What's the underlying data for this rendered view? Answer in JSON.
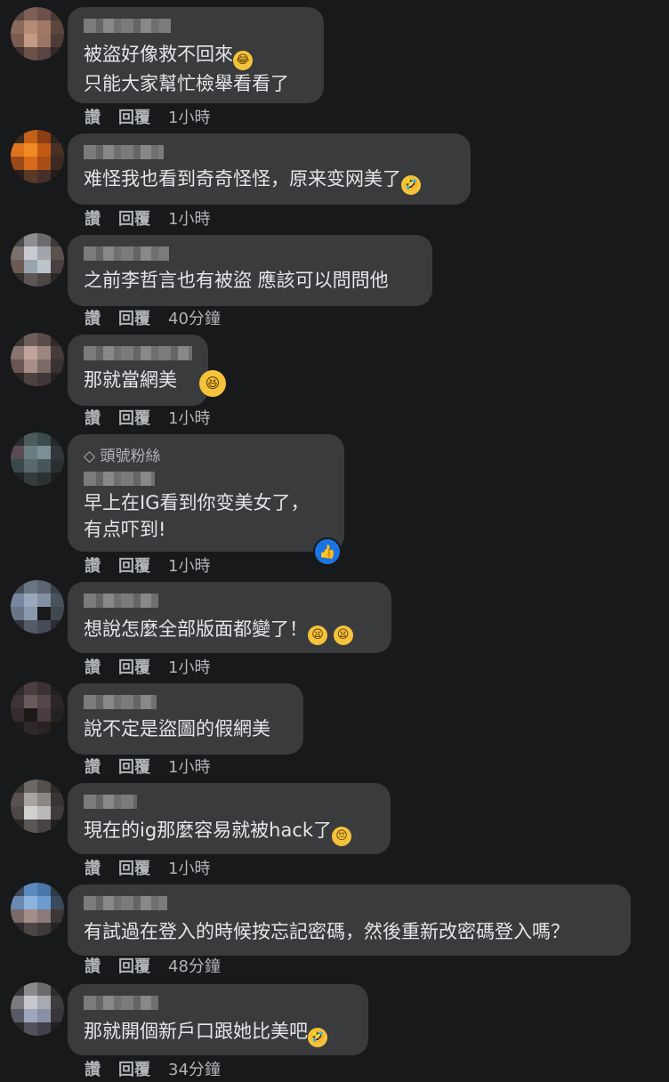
{
  "comments": [
    {
      "lines": [
        "被盜好像救不回來",
        "只能大家幫忙檢舉看看了"
      ],
      "emoji": [
        "crying-laughing-face"
      ],
      "like": "讚",
      "reply": "回覆",
      "time": "1小時"
    },
    {
      "lines": [
        "难怪我也看到奇奇怪怪，原来变网美了"
      ],
      "emoji": [
        "rolling-laughing-face"
      ],
      "like": "讚",
      "reply": "回覆",
      "time": "1小時"
    },
    {
      "lines": [
        "之前李哲言也有被盜 應該可以問問他"
      ],
      "like": "讚",
      "reply": "回覆",
      "time": "40分鐘"
    },
    {
      "lines": [
        "那就當網美"
      ],
      "emoji": [
        "squinting-face"
      ],
      "like": "讚",
      "reply": "回覆",
      "time": "1小時"
    },
    {
      "badge": "頭號粉絲",
      "lines": [
        "早上在IG看到你变美女了，",
        "有点吓到!"
      ],
      "reaction": "like",
      "like": "讚",
      "reply": "回覆",
      "time": "1小時"
    },
    {
      "lines": [
        "想說怎麼全部版面都變了！"
      ],
      "emoji": [
        "frowning-face",
        "frowning-face"
      ],
      "like": "讚",
      "reply": "回覆",
      "time": "1小時"
    },
    {
      "lines": [
        "說不定是盜圖的假網美"
      ],
      "like": "讚",
      "reply": "回覆",
      "time": "1小時"
    },
    {
      "lines": [
        "現在的ig那麼容易就被hack了"
      ],
      "emoji": [
        "pensive-face"
      ],
      "like": "讚",
      "reply": "回覆",
      "time": "1小時"
    },
    {
      "lines": [
        "有試過在登入的時候按忘記密碼，然後重新改密碼登入嗎？"
      ],
      "like": "讚",
      "reply": "回覆",
      "time": "48分鐘"
    },
    {
      "lines": [
        "那就開個新戶口跟她比美吧"
      ],
      "emoji": [
        "rolling-laughing-face"
      ],
      "like": "讚",
      "reply": "回覆",
      "time": "34分鐘"
    }
  ],
  "colors": {
    "background": "#18191a",
    "bubble": "#3a3b3c",
    "text": "#e4e6eb",
    "secondary": "#b0b3b8",
    "like_blue": "#1b74e4"
  }
}
